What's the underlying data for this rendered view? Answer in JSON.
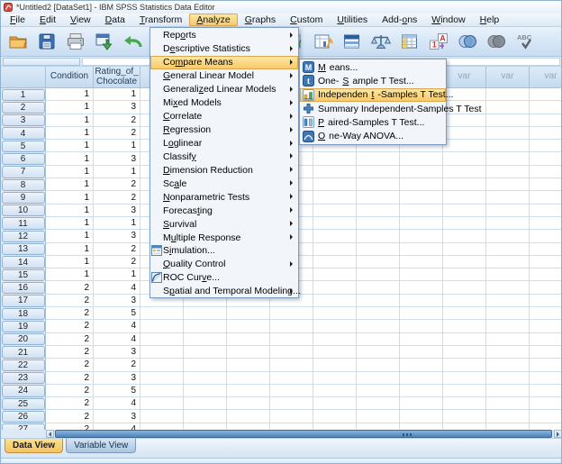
{
  "window": {
    "title": "*Untitled2 [DataSet1] - IBM SPSS Statistics Data Editor"
  },
  "menubar": {
    "active": "Analyze",
    "items": [
      {
        "label": "File",
        "underline": 0
      },
      {
        "label": "Edit",
        "underline": 0
      },
      {
        "label": "View",
        "underline": 0
      },
      {
        "label": "Data",
        "underline": 0
      },
      {
        "label": "Transform",
        "underline": 0
      },
      {
        "label": "Analyze",
        "underline": 0
      },
      {
        "label": "Graphs",
        "underline": 0
      },
      {
        "label": "Custom",
        "underline": 0
      },
      {
        "label": "Utilities",
        "underline": 0
      },
      {
        "label": "Add-ons",
        "underline": 4
      },
      {
        "label": "Window",
        "underline": 0
      },
      {
        "label": "Help",
        "underline": 0
      }
    ]
  },
  "toolbar": {
    "left_buttons": [
      {
        "name": "open-data-file",
        "disabled": false
      },
      {
        "name": "save-file",
        "disabled": false
      },
      {
        "name": "print",
        "disabled": false
      },
      {
        "name": "recall-dialogs",
        "disabled": false
      },
      {
        "name": "undo",
        "disabled": false
      },
      {
        "name": "redo",
        "disabled": false
      }
    ],
    "right_buttons": [
      {
        "name": "goto-case",
        "disabled": false
      },
      {
        "name": "variables",
        "disabled": false
      },
      {
        "name": "find",
        "disabled": false
      },
      {
        "name": "weight-cases",
        "disabled": false
      },
      {
        "name": "split-file",
        "disabled": false
      },
      {
        "name": "value-labels",
        "disabled": false
      },
      {
        "name": "use-variable-sets",
        "disabled": false
      },
      {
        "name": "show-all-variables",
        "disabled": true
      },
      {
        "name": "spell-check",
        "disabled": true
      }
    ]
  },
  "editbar": {
    "cell_ref": "",
    "cell_value": ""
  },
  "grid": {
    "var_column_label": "var",
    "columns": [
      {
        "label": "Condition"
      },
      {
        "label": "Rating_of_Chocolate"
      }
    ],
    "rows": [
      {
        "n": 1,
        "values": [
          1,
          1
        ]
      },
      {
        "n": 2,
        "values": [
          1,
          3
        ]
      },
      {
        "n": 3,
        "values": [
          1,
          2
        ]
      },
      {
        "n": 4,
        "values": [
          1,
          2
        ]
      },
      {
        "n": 5,
        "values": [
          1,
          1
        ]
      },
      {
        "n": 6,
        "values": [
          1,
          3
        ]
      },
      {
        "n": 7,
        "values": [
          1,
          1
        ]
      },
      {
        "n": 8,
        "values": [
          1,
          2
        ]
      },
      {
        "n": 9,
        "values": [
          1,
          2
        ]
      },
      {
        "n": 10,
        "values": [
          1,
          3
        ]
      },
      {
        "n": 11,
        "values": [
          1,
          1
        ]
      },
      {
        "n": 12,
        "values": [
          1,
          3
        ]
      },
      {
        "n": 13,
        "values": [
          1,
          2
        ]
      },
      {
        "n": 14,
        "values": [
          1,
          2
        ]
      },
      {
        "n": 15,
        "values": [
          1,
          1
        ]
      },
      {
        "n": 16,
        "values": [
          2,
          4
        ]
      },
      {
        "n": 17,
        "values": [
          2,
          3
        ]
      },
      {
        "n": 18,
        "values": [
          2,
          5
        ]
      },
      {
        "n": 19,
        "values": [
          2,
          4
        ]
      },
      {
        "n": 20,
        "values": [
          2,
          4
        ]
      },
      {
        "n": 21,
        "values": [
          2,
          3
        ]
      },
      {
        "n": 22,
        "values": [
          2,
          2
        ]
      },
      {
        "n": 23,
        "values": [
          2,
          3
        ]
      },
      {
        "n": 24,
        "values": [
          2,
          5
        ]
      },
      {
        "n": 25,
        "values": [
          2,
          4
        ]
      },
      {
        "n": 26,
        "values": [
          2,
          3
        ]
      },
      {
        "n": 27,
        "values": [
          2,
          4
        ]
      }
    ]
  },
  "analyze_menu": {
    "items": [
      {
        "label": "Reports",
        "underline": 3,
        "arrow": true
      },
      {
        "label": "Descriptive Statistics",
        "underline": 1,
        "arrow": true
      },
      {
        "label": "Compare Means",
        "underline": 2,
        "arrow": true,
        "highlighted": true
      },
      {
        "label": "General Linear Model",
        "underline": 0,
        "arrow": true
      },
      {
        "label": "Generalized Linear Models",
        "underline": 8,
        "arrow": true
      },
      {
        "label": "Mixed Models",
        "underline": 2,
        "arrow": true
      },
      {
        "label": "Correlate",
        "underline": 0,
        "arrow": true
      },
      {
        "label": "Regression",
        "underline": 0,
        "arrow": true
      },
      {
        "label": "Loglinear",
        "underline": 1,
        "arrow": true
      },
      {
        "label": "Classify",
        "underline": 7,
        "arrow": true
      },
      {
        "label": "Dimension Reduction",
        "underline": 0,
        "arrow": true
      },
      {
        "label": "Scale",
        "underline": 2,
        "arrow": true
      },
      {
        "label": "Nonparametric Tests",
        "underline": 0,
        "arrow": true
      },
      {
        "label": "Forecasting",
        "underline": 7,
        "arrow": true
      },
      {
        "label": "Survival",
        "underline": 0,
        "arrow": true
      },
      {
        "label": "Multiple Response",
        "underline": 1,
        "arrow": true
      },
      {
        "label": "Simulation...",
        "underline": 1,
        "arrow": false,
        "icon": "simulation"
      },
      {
        "label": "Quality Control",
        "underline": 0,
        "arrow": true
      },
      {
        "label": "ROC Curve...",
        "underline": 7,
        "arrow": false,
        "icon": "roc-curve"
      },
      {
        "label": "Spatial and Temporal Modeling...",
        "underline": 1,
        "arrow": true
      }
    ]
  },
  "compare_means_submenu": {
    "items": [
      {
        "label": "Means...",
        "underline": 0,
        "icon": "means"
      },
      {
        "label": "One-Sample T Test...",
        "underline": 4,
        "icon": "one-sample-t-test"
      },
      {
        "label": "Independent-Samples T Test...",
        "underline": 10,
        "icon": "independent-samples-t-test",
        "highlighted": true
      },
      {
        "label": "Summary Independent-Samples T Test",
        "underline": -1,
        "icon": "summary-independent-samples"
      },
      {
        "label": "Paired-Samples T Test...",
        "underline": 0,
        "icon": "paired-samples-t-test"
      },
      {
        "label": "One-Way ANOVA...",
        "underline": 0,
        "icon": "one-way-anova"
      }
    ]
  },
  "tabs": {
    "active": "Data View",
    "items": [
      {
        "label": "Data View"
      },
      {
        "label": "Variable View"
      }
    ]
  }
}
